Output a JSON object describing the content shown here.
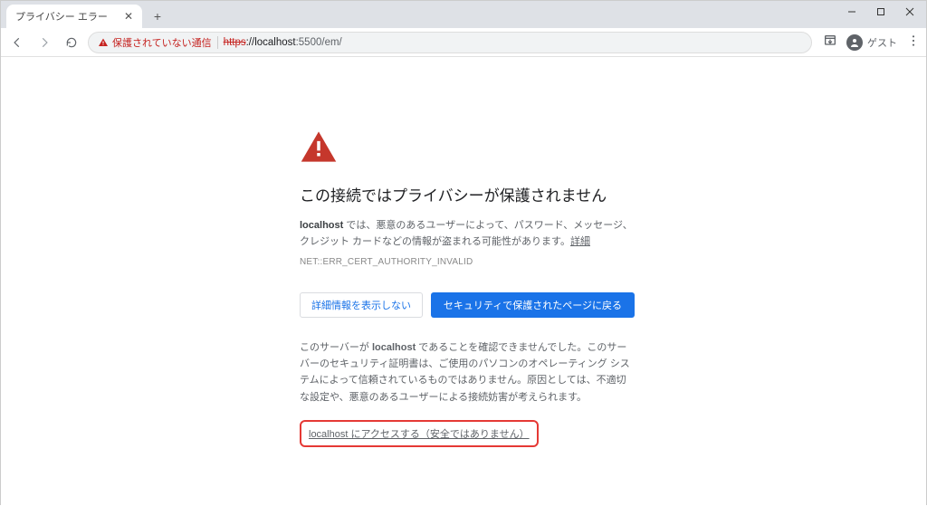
{
  "tab": {
    "title": "プライバシー エラー"
  },
  "security": {
    "warn_label": "保護されていない通信"
  },
  "url": {
    "scheme": "https",
    "host": "://localhost",
    "port_path": ":5500/em/"
  },
  "guest_label": "ゲスト",
  "page": {
    "headline": "この接続ではプライバシーが保護されません",
    "body_prefix": "localhost",
    "body_text": " では、悪意のあるユーザーによって、パスワード、メッセージ、クレジット カードなどの情報が盗まれる可能性があります。",
    "learn_more": "詳細",
    "error_code": "NET::ERR_CERT_AUTHORITY_INVALID",
    "hide_details_label": "詳細情報を表示しない",
    "back_safety_label": "セキュリティで保護されたページに戻る",
    "explain_prefix": "このサーバーが ",
    "explain_host": "localhost",
    "explain_rest": " であることを確認できませんでした。このサーバーのセキュリティ証明書は、ご使用のパソコンのオペレーティング システムによって信頼されているものではありません。原因としては、不適切な設定や、悪意のあるユーザーによる接続妨害が考えられます。",
    "proceed_label": "localhost にアクセスする（安全ではありません）"
  }
}
